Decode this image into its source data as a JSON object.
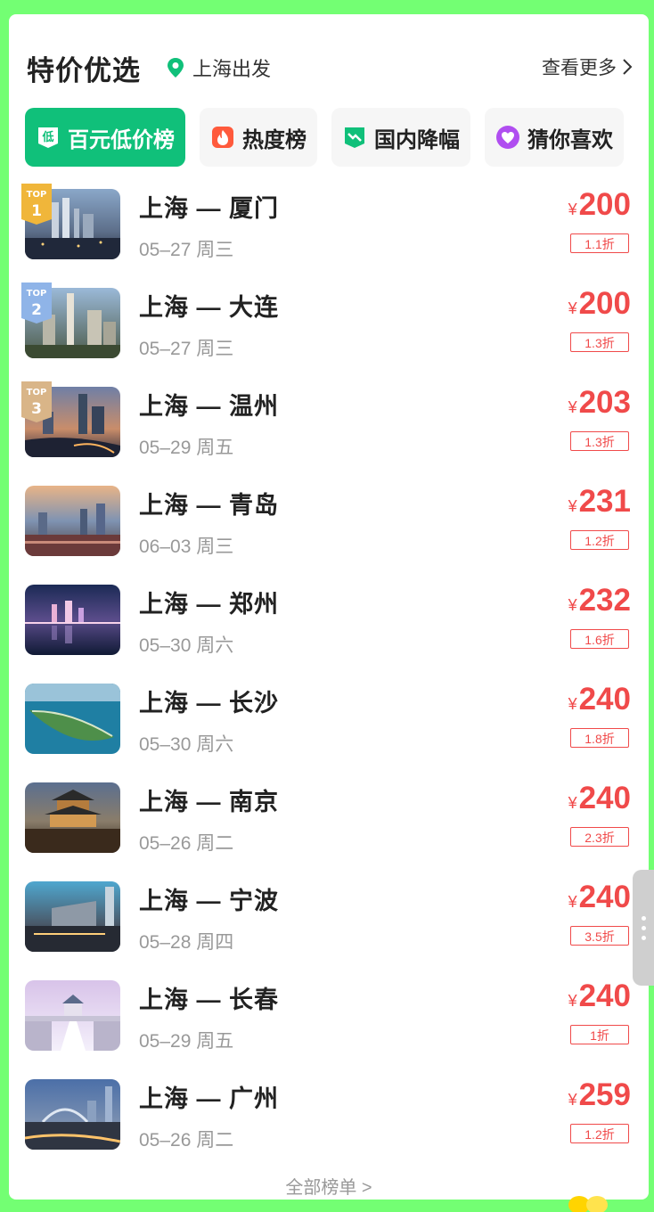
{
  "header": {
    "title": "特价优选",
    "location": "上海出发",
    "more": "查看更多"
  },
  "tabs": [
    {
      "label": "百元低价榜",
      "icon": "low-price-icon",
      "active": true
    },
    {
      "label": "热度榜",
      "icon": "fire-icon",
      "active": false
    },
    {
      "label": "国内降幅",
      "icon": "drop-icon",
      "active": false
    },
    {
      "label": "猜你喜欢",
      "icon": "heart-icon",
      "active": false
    }
  ],
  "colors": {
    "accent": "#10c07a",
    "price": "#f04a4a",
    "bg": "#73ff73"
  },
  "routes": [
    {
      "route": "上海 — 厦门",
      "date": "05–27 周三",
      "price": "200",
      "discount": "1.1折",
      "rank": "1"
    },
    {
      "route": "上海 — 大连",
      "date": "05–27 周三",
      "price": "200",
      "discount": "1.3折",
      "rank": "2"
    },
    {
      "route": "上海 — 温州",
      "date": "05–29 周五",
      "price": "203",
      "discount": "1.3折",
      "rank": "3"
    },
    {
      "route": "上海 — 青岛",
      "date": "06–03 周三",
      "price": "231",
      "discount": "1.2折",
      "rank": ""
    },
    {
      "route": "上海 — 郑州",
      "date": "05–30 周六",
      "price": "232",
      "discount": "1.6折",
      "rank": ""
    },
    {
      "route": "上海 — 长沙",
      "date": "05–30 周六",
      "price": "240",
      "discount": "1.8折",
      "rank": ""
    },
    {
      "route": "上海 — 南京",
      "date": "05–26 周二",
      "price": "240",
      "discount": "2.3折",
      "rank": ""
    },
    {
      "route": "上海 — 宁波",
      "date": "05–28 周四",
      "price": "240",
      "discount": "3.5折",
      "rank": ""
    },
    {
      "route": "上海 — 长春",
      "date": "05–29 周五",
      "price": "240",
      "discount": "1折",
      "rank": ""
    },
    {
      "route": "上海 — 广州",
      "date": "05–26 周二",
      "price": "259",
      "discount": "1.2折",
      "rank": ""
    }
  ],
  "rank_label": "TOP",
  "currency": "¥",
  "footer": "全部榜单 >"
}
